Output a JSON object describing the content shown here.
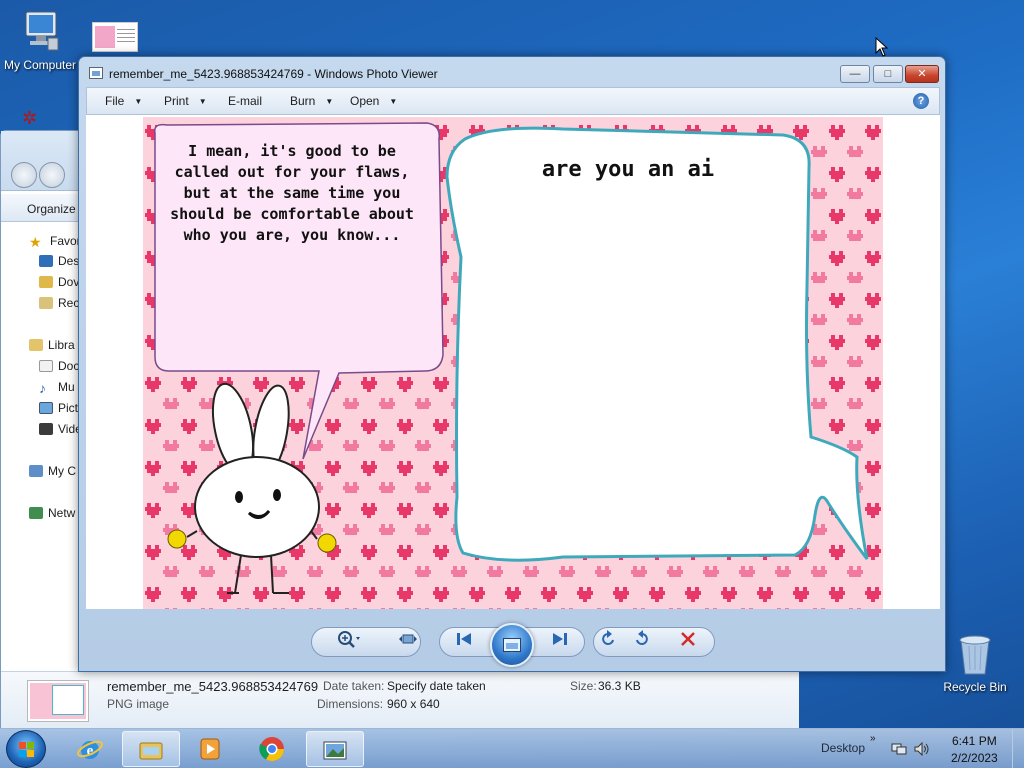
{
  "desktop": {
    "icons": [
      {
        "label": "My Computer"
      },
      {
        "label": "Recycle Bin"
      }
    ]
  },
  "explorer": {
    "organize_label": "Organize",
    "tree": [
      {
        "label": "Favor",
        "icon": "star-icon"
      },
      {
        "label": "Des",
        "icon": "desktop-icon"
      },
      {
        "label": "Dov",
        "icon": "downloads-icon"
      },
      {
        "label": "Rec",
        "icon": "recent-places-icon"
      },
      {
        "label": "Libra",
        "icon": "libraries-icon"
      },
      {
        "label": "Doc",
        "icon": "documents-icon"
      },
      {
        "label": "Mu",
        "icon": "music-icon"
      },
      {
        "label": "Pict",
        "icon": "pictures-icon"
      },
      {
        "label": "Vide",
        "icon": "videos-icon"
      },
      {
        "label": "My C",
        "icon": "computer-icon"
      },
      {
        "label": "Netw",
        "icon": "network-icon"
      }
    ],
    "details": {
      "filename": "remember_me_5423.968853424769",
      "filetype": "PNG image",
      "date_taken_label": "Date taken:",
      "date_taken_value": "Specify date taken",
      "dimensions_label": "Dimensions:",
      "dimensions_value": "960 x 640",
      "size_label": "Size:",
      "size_value": "36.3 KB"
    }
  },
  "viewer": {
    "title": "remember_me_5423.968853424769 - Windows Photo Viewer",
    "menu": {
      "file": "File",
      "print": "Print",
      "email": "E-mail",
      "burn": "Burn",
      "open": "Open"
    },
    "help_glyph": "?",
    "image": {
      "left_bubble_text": "I mean, it's good to be called out for your flaws, but at the same time you should be comfortable about who you are, you know...",
      "right_bubble_text": "are you an ai"
    }
  },
  "taskbar": {
    "desktop_label": "Desktop",
    "time": "6:41 PM",
    "date": "2/2/2023"
  },
  "colors": {
    "pink_bg": "#fcd2dc",
    "heart": "#e8386a",
    "bubble_border": "#4bb9c9",
    "left_bubble_fill": "#fde6f8"
  }
}
